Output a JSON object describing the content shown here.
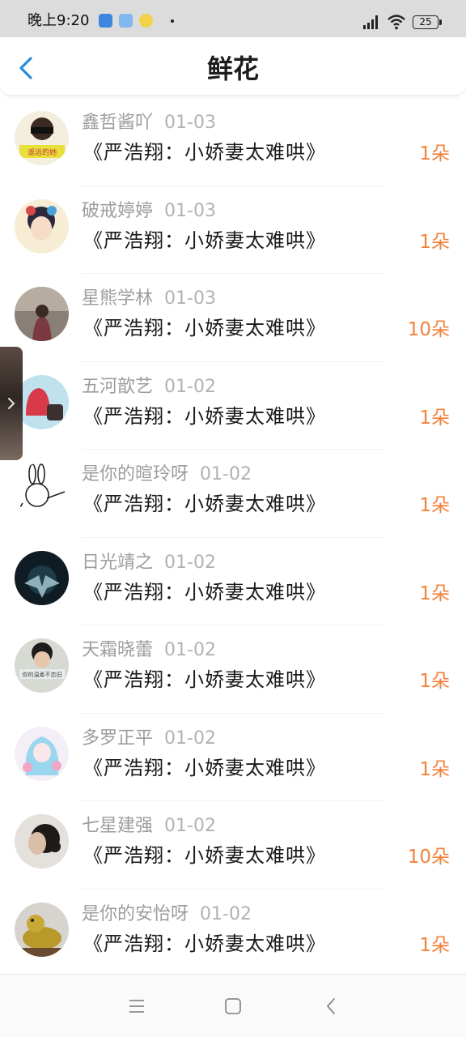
{
  "status_bar": {
    "time": "晚上9:20",
    "battery": "25"
  },
  "nav": {
    "title": "鲜花",
    "back_icon": "chevron-left-icon"
  },
  "accent_colors": {
    "quantity": "#f2813a",
    "back_arrow": "#2a8ad8"
  },
  "rows": [
    {
      "user": "鑫哲酱吖",
      "date": "01-03",
      "book": "《严浩翔：小娇妻太难哄》",
      "quantity": "1朵"
    },
    {
      "user": "破戒婷婷",
      "date": "01-03",
      "book": "《严浩翔：小娇妻太难哄》",
      "quantity": "1朵"
    },
    {
      "user": "星熊学林",
      "date": "01-03",
      "book": "《严浩翔：小娇妻太难哄》",
      "quantity": "10朵"
    },
    {
      "user": "五河歆艺",
      "date": "01-02",
      "book": "《严浩翔：小娇妻太难哄》",
      "quantity": "1朵"
    },
    {
      "user": "是你的暄玲呀",
      "date": "01-02",
      "book": "《严浩翔：小娇妻太难哄》",
      "quantity": "1朵"
    },
    {
      "user": "日光靖之",
      "date": "01-02",
      "book": "《严浩翔：小娇妻太难哄》",
      "quantity": "1朵"
    },
    {
      "user": "天霜晓蕾",
      "date": "01-02",
      "book": "《严浩翔：小娇妻太难哄》",
      "quantity": "1朵"
    },
    {
      "user": "多罗正平",
      "date": "01-02",
      "book": "《严浩翔：小娇妻太难哄》",
      "quantity": "1朵"
    },
    {
      "user": "七星建强",
      "date": "01-02",
      "book": "《严浩翔：小娇妻太难哄》",
      "quantity": "10朵"
    },
    {
      "user": "是你的安怡呀",
      "date": "01-02",
      "book": "《严浩翔：小娇妻太难哄》",
      "quantity": "1朵"
    }
  ],
  "avatar_stickers": {
    "row0": "遥远的她",
    "row6": "你的温柔不恋旧"
  },
  "system_nav": {
    "menu_icon": "menu-icon",
    "home_icon": "home-icon",
    "back_icon": "back-icon"
  }
}
